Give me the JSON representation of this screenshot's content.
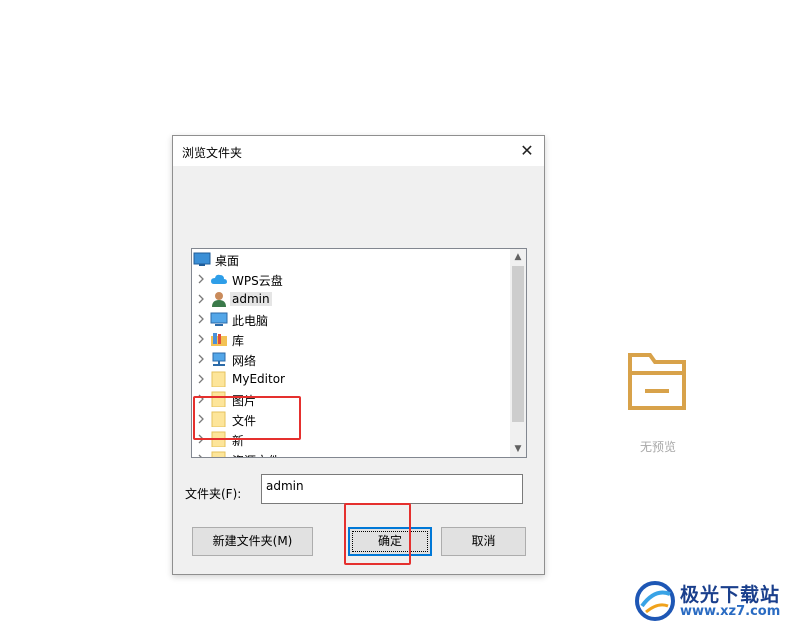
{
  "dialog": {
    "title": "浏览文件夹",
    "close_glyph": "✕",
    "tree": {
      "items": [
        {
          "label": "桌面",
          "icon": "desktop-icon",
          "expandable": false,
          "selected": false
        },
        {
          "label": "WPS云盘",
          "icon": "cloud-icon",
          "expandable": true,
          "selected": false
        },
        {
          "label": "admin",
          "icon": "user-icon",
          "expandable": true,
          "selected": true
        },
        {
          "label": "此电脑",
          "icon": "computer-icon",
          "expandable": true,
          "selected": false
        },
        {
          "label": "库",
          "icon": "library-icon",
          "expandable": true,
          "selected": false
        },
        {
          "label": "网络",
          "icon": "network-icon",
          "expandable": true,
          "selected": false
        },
        {
          "label": "MyEditor",
          "icon": "folder-icon",
          "expandable": true,
          "selected": false
        },
        {
          "label": "图片",
          "icon": "folder-icon",
          "expandable": true,
          "selected": false
        },
        {
          "label": "文件",
          "icon": "folder-icon",
          "expandable": true,
          "selected": false
        },
        {
          "label": "新",
          "icon": "folder-icon",
          "expandable": true,
          "selected": false
        },
        {
          "label": "资源文件",
          "icon": "folder-icon",
          "expandable": true,
          "selected": false
        }
      ]
    },
    "folder_label": "文件夹(F):",
    "folder_value": "admin",
    "buttons": {
      "new_folder": "新建文件夹(M)",
      "ok": "确定",
      "cancel": "取消"
    }
  },
  "preview": {
    "text": "无预览",
    "icon": "folder-preview-icon",
    "color": "#d8a24a"
  },
  "watermark": {
    "title": "极光下载站",
    "url": "www.xz7.com"
  },
  "colors": {
    "annotation_red": "#e5302e",
    "focus_blue": "#0078d7"
  }
}
